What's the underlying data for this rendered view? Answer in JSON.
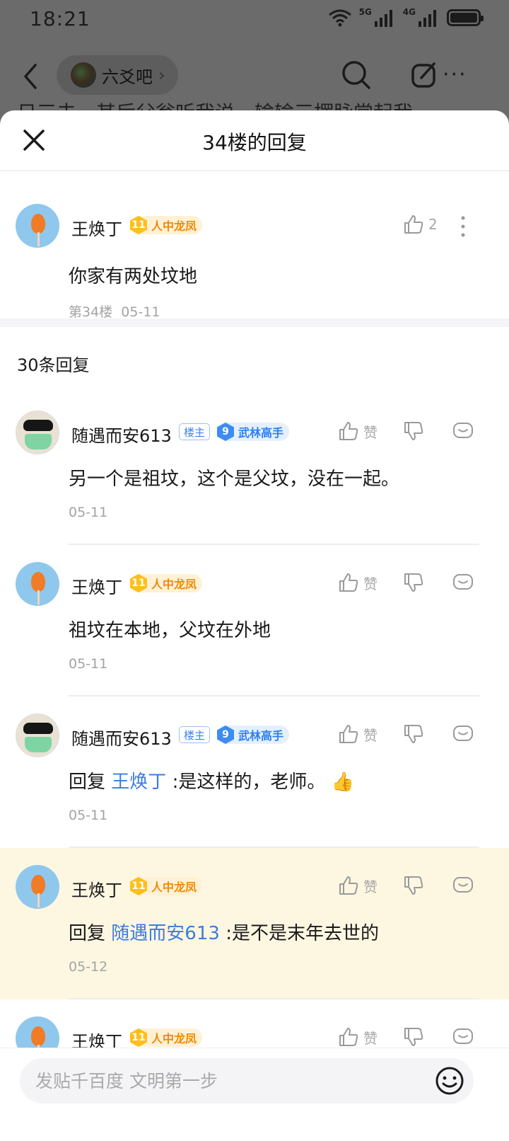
{
  "status": {
    "time": "18:21",
    "net1": "5G",
    "net2": "4G"
  },
  "nav": {
    "forum_name": "六爻吧",
    "chevron": "›",
    "more": "···"
  },
  "background_peek": "日三去，其后父翁听我说，输输三摆脉常起我~",
  "sheet": {
    "title": "34楼的回复"
  },
  "main_comment": {
    "user": "王焕丁",
    "badge_level": "11",
    "badge_title": "人中龙凤",
    "likes": "2",
    "text": "你家有两处坟地",
    "floor": "第34楼",
    "date": "05-11"
  },
  "replies_count": "30条回复",
  "like_label": "赞",
  "lz_label": "楼主",
  "replies": [
    {
      "user": "随遇而安613",
      "lz": true,
      "badge_level": "9",
      "badge_title": "武林高手",
      "badge_color": "blue",
      "text": "另一个是祖坟，这个是父坟，没在一起。",
      "date": "05-11"
    },
    {
      "user": "王焕丁",
      "lz": false,
      "badge_level": "11",
      "badge_title": "人中龙凤",
      "badge_color": "gold",
      "text": "祖坟在本地，父坟在外地",
      "date": "05-11"
    },
    {
      "user": "随遇而安613",
      "lz": true,
      "badge_level": "9",
      "badge_title": "武林高手",
      "badge_color": "blue",
      "reply_prefix": "回复",
      "reply_to": "王焕丁",
      "text": ":是这样的，老师。 👍",
      "date": "05-11"
    },
    {
      "user": "王焕丁",
      "lz": false,
      "badge_level": "11",
      "badge_title": "人中龙凤",
      "badge_color": "gold",
      "reply_prefix": "回复",
      "reply_to": "随遇而安613",
      "text": ":是不是末年去世的",
      "date": "05-12"
    },
    {
      "user": "王焕丁",
      "lz": false,
      "badge_level": "11",
      "badge_title": "人中龙凤",
      "badge_color": "gold",
      "text": "",
      "date": ""
    }
  ],
  "input": {
    "placeholder": "发贴千百度 文明第一步"
  },
  "colors": {
    "highlight_row": "#fdf7e2",
    "link": "#3c7ce0",
    "gold_badge": "#f08a00",
    "blue_badge": "#2f7ff0"
  }
}
